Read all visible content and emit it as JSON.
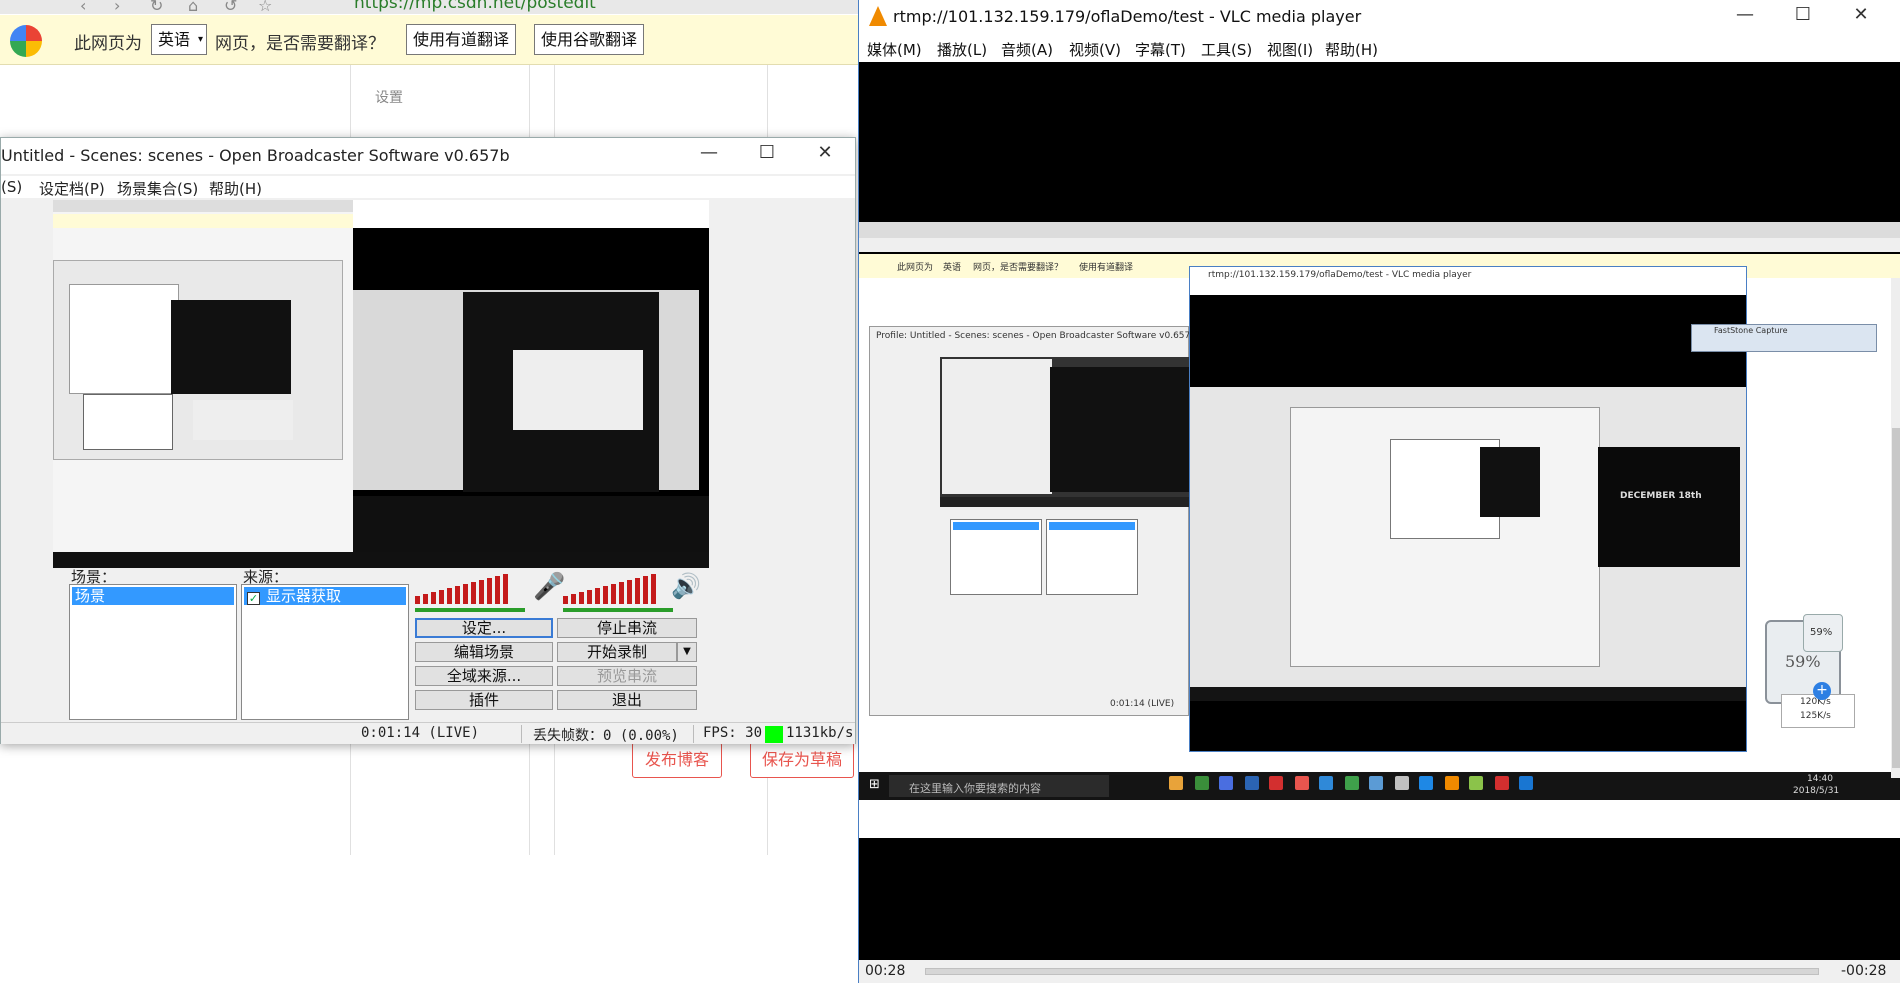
{
  "browser": {
    "url": "https://mp.csdn.net/postedit",
    "translate_bar": {
      "prefix": "此网页为",
      "language": "英语",
      "suffix": "网页，是否需要翻译？",
      "youdao_button": "使用有道翻译",
      "google_button": "使用谷歌翻译"
    },
    "settings_label": "设置",
    "publish_button": "发布博客",
    "draft_button": "保存为草稿"
  },
  "obs": {
    "title": "Untitled - Scenes: scenes - Open Broadcaster Software v0.657b",
    "menu": [
      "(S)",
      "设定档(P)",
      "场景集合(S)",
      "帮助(H)"
    ],
    "scenes_label": "场景：",
    "scenes": [
      "场景"
    ],
    "sources_label": "来源：",
    "sources": [
      {
        "name": "显示器获取",
        "checked": true
      }
    ],
    "buttons": {
      "settings": "设定...",
      "stop_stream": "停止串流",
      "edit_scene": "编辑场景",
      "start_record": "开始录制",
      "global_sources": "全域来源...",
      "preview_stream": "预览串流",
      "plugins": "插件",
      "exit": "退出"
    },
    "status": {
      "time": "0:01:14 (LIVE)",
      "dropped_frames": "丢失帧数：0 (0.00%)",
      "fps": "FPS: 30",
      "bitrate": "1131kb/s",
      "bitrate_color": "#00ff00"
    }
  },
  "vlc": {
    "title": "rtmp://101.132.159.179/oflaDemo/test - VLC media player",
    "menu": [
      "媒体(M)",
      "播放(L)",
      "音频(A)",
      "视频(V)",
      "字幕(T)",
      "工具(S)",
      "视图(I)",
      "帮助(H)"
    ],
    "time_elapsed": "00:28",
    "time_remaining": "-00:28",
    "video_overlay": {
      "translate_prefix": "此网页为",
      "translate_lang": "英语",
      "translate_suffix": "网页，是否需要翻译？",
      "youdao": "使用有道翻译",
      "inner_vlc_title": "rtmp://101.132.159.179/oflaDemo/test - VLC media player",
      "inner_obs_title": "Profile: Untitled - Scenes: scenes - Open Broadcaster Software v0.657b",
      "inner_obs_time": "0:01:14 (LIVE)",
      "taskbar_search": "在这里输入你要搜索的内容",
      "taskbar_time": "14:40",
      "taskbar_date": "2018/5/31",
      "net_percent": "59%",
      "net_up": "120K/s",
      "net_down": "125K/s",
      "inner_percent": "59%",
      "fs_capture_title": "FastStone Capture",
      "movie_text": "DECEMBER 18th"
    }
  },
  "colors": {
    "obs_meter_red": "#c41a1a",
    "selection_blue": "#3399ff",
    "csdn_red": "#e8554e",
    "vlc_orange": "#f08a00"
  }
}
